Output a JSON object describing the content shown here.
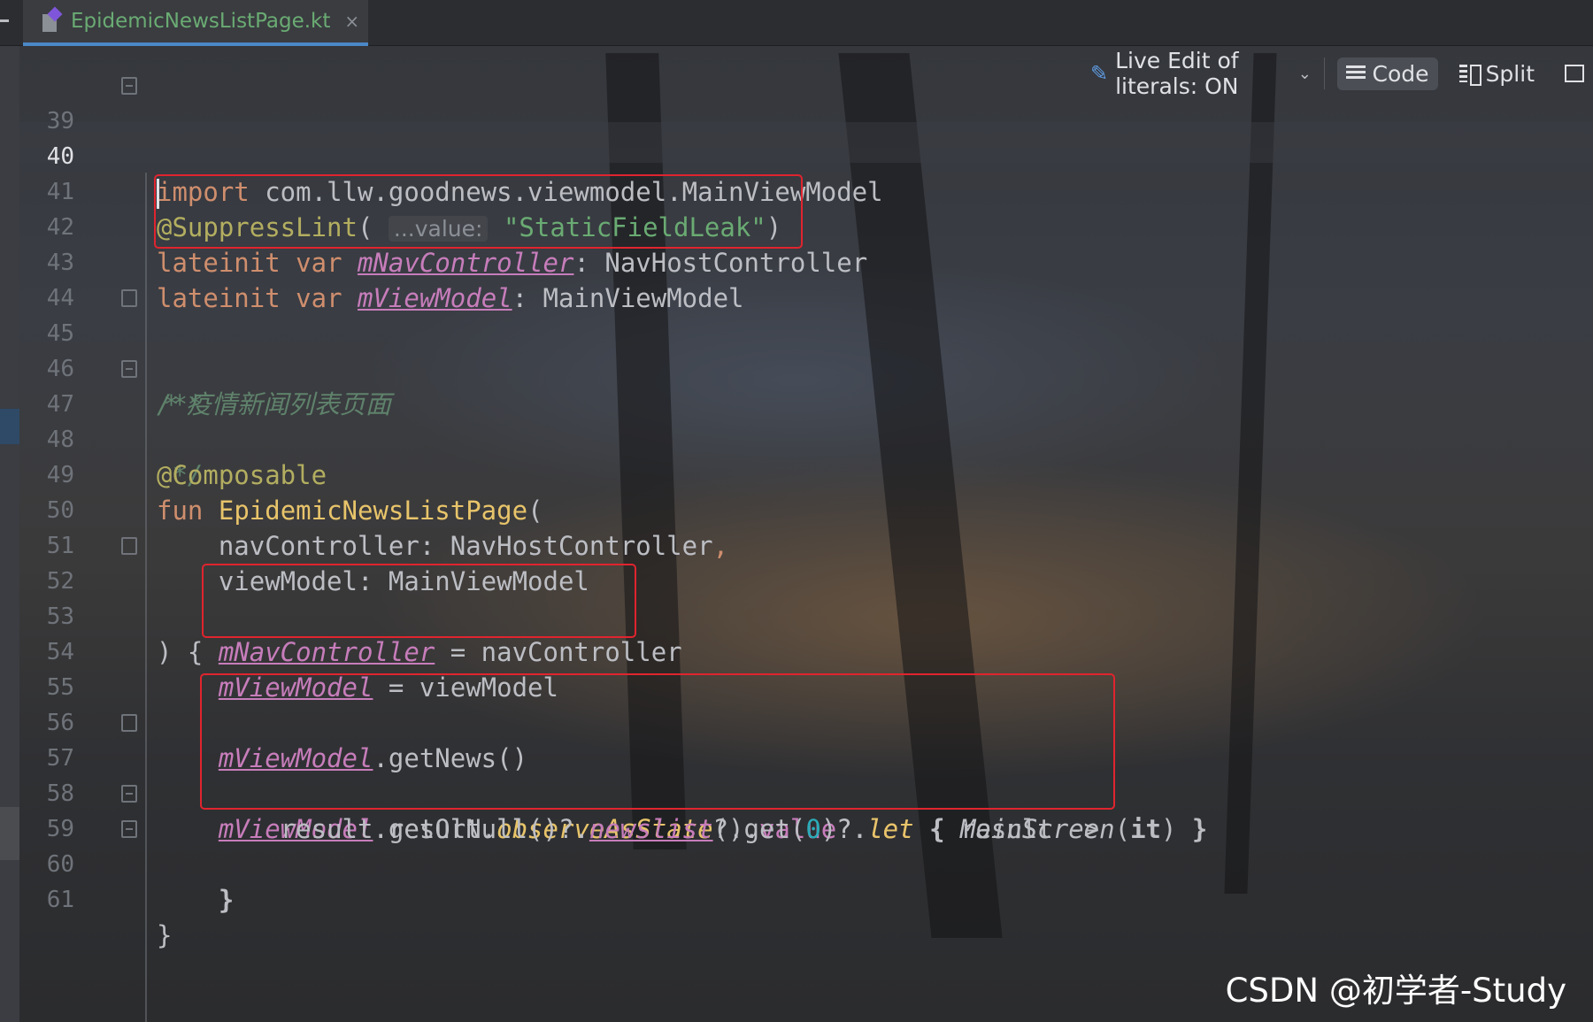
{
  "tab": {
    "filename": "EpidemicNewsListPage.kt",
    "close": "×"
  },
  "toolbar": {
    "live_edit": "Live Edit of literals: ON",
    "code": "Code",
    "split": "Split"
  },
  "lines": {
    "n39": "39",
    "n40": "40",
    "n41": "41",
    "n42": "42",
    "n43": "43",
    "n44": "44",
    "n45": "45",
    "n46": "46",
    "n47": "47",
    "n48": "48",
    "n49": "49",
    "n50": "50",
    "n51": "51",
    "n52": "52",
    "n53": "53",
    "n54": "54",
    "n55": "55",
    "n56": "56",
    "n57": "57",
    "n58": "58",
    "n59": "59",
    "n60": "60",
    "n61": "61"
  },
  "code": {
    "l39_kw": "import",
    "l39_rest": " com.llw.goodnews.viewmodel.MainViewModel",
    "l41_ann": "@SuppressLint",
    "l41_hint": "...value:",
    "l41_str": "\"StaticFieldLeak\"",
    "lateinit": "lateinit",
    "var": "var",
    "mNavController": "mNavController",
    "mViewModel": "mViewModel",
    "NavHostController": "NavHostController",
    "MainViewModel": "MainViewModel",
    "doc_open": "/**",
    "doc_text": " * 疫情新闻列表页面",
    "doc_close": " */",
    "composable": "@Composable",
    "fun": "fun",
    "fn_name": "EpidemicNewsListPage",
    "param1": "navController",
    "param2": "viewModel",
    "getNews": ".getNews()",
    "result": ".result.",
    "observe": "observeAsState",
    "value": "value",
    "let": "let",
    "result_arrow": " result ->",
    "result_get": "result.getOrNull()?.",
    "newslist": "newslist",
    "get0_a": "?.get(",
    "zero": "0",
    "get0_b": ")?.",
    "mainscreen": "MainScreen",
    "it": "it"
  },
  "watermark": "CSDN @初学者-Study"
}
